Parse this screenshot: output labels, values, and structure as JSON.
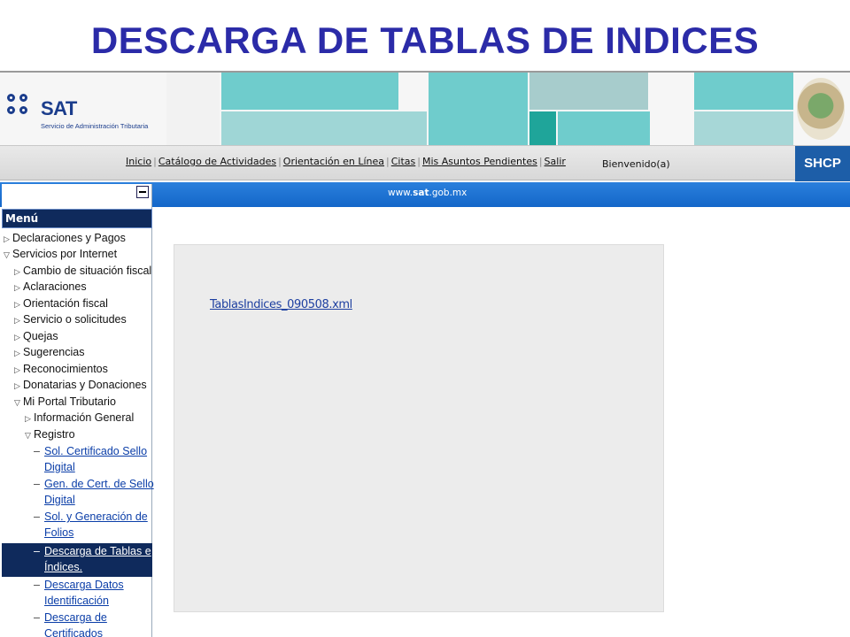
{
  "slide": {
    "title": "DESCARGA DE TABLAS DE INDICES"
  },
  "logo": {
    "name": "SAT",
    "subtitle": "Servicio de Administración Tributaria"
  },
  "nav": {
    "links": [
      "Inicio",
      "Catálogo de Actividades",
      "Orientación en Línea",
      "Citas",
      "Mis Asuntos Pendientes",
      "Salir"
    ],
    "welcome": "Bienvenido(a)",
    "shcp": "SHCP"
  },
  "site": {
    "url_prefix": "www.",
    "url_bold": "sat",
    "url_suffix": ".gob.mx"
  },
  "menu": {
    "title": "Menú",
    "items": [
      {
        "label": "Declaraciones y Pagos"
      },
      {
        "label": "Servicios por Internet"
      },
      {
        "label": "Cambio de situación fiscal"
      },
      {
        "label": "Aclaraciones"
      },
      {
        "label": "Orientación fiscal"
      },
      {
        "label": "Servicio o solicitudes"
      },
      {
        "label": "Quejas"
      },
      {
        "label": "Sugerencias"
      },
      {
        "label": "Reconocimientos"
      },
      {
        "label": "Donatarias y Donaciones"
      },
      {
        "label": "Mi Portal Tributario"
      },
      {
        "label": "Información General"
      },
      {
        "label": "Registro"
      }
    ],
    "registro_links": [
      {
        "line1": "Sol. Certificado Sello",
        "line2": "Digital"
      },
      {
        "line1": "Gen. de Cert. de Sello",
        "line2": "Digital"
      },
      {
        "line1": "Sol. y Generación de",
        "line2": "Folios"
      },
      {
        "line1": "Descarga de Tablas e",
        "line2": "Índices."
      },
      {
        "line1": "Descarga Datos",
        "line2": "Identificación"
      },
      {
        "line1": "Descarga de",
        "line2": "Certificados"
      }
    ]
  },
  "content": {
    "file_link": "TablasIndices_090508.xml"
  },
  "colors": {
    "title": "#2b2ba8",
    "menu_bg": "#0f2a5c",
    "bluebar": "#1467c9",
    "teal": "#6fcccc"
  }
}
